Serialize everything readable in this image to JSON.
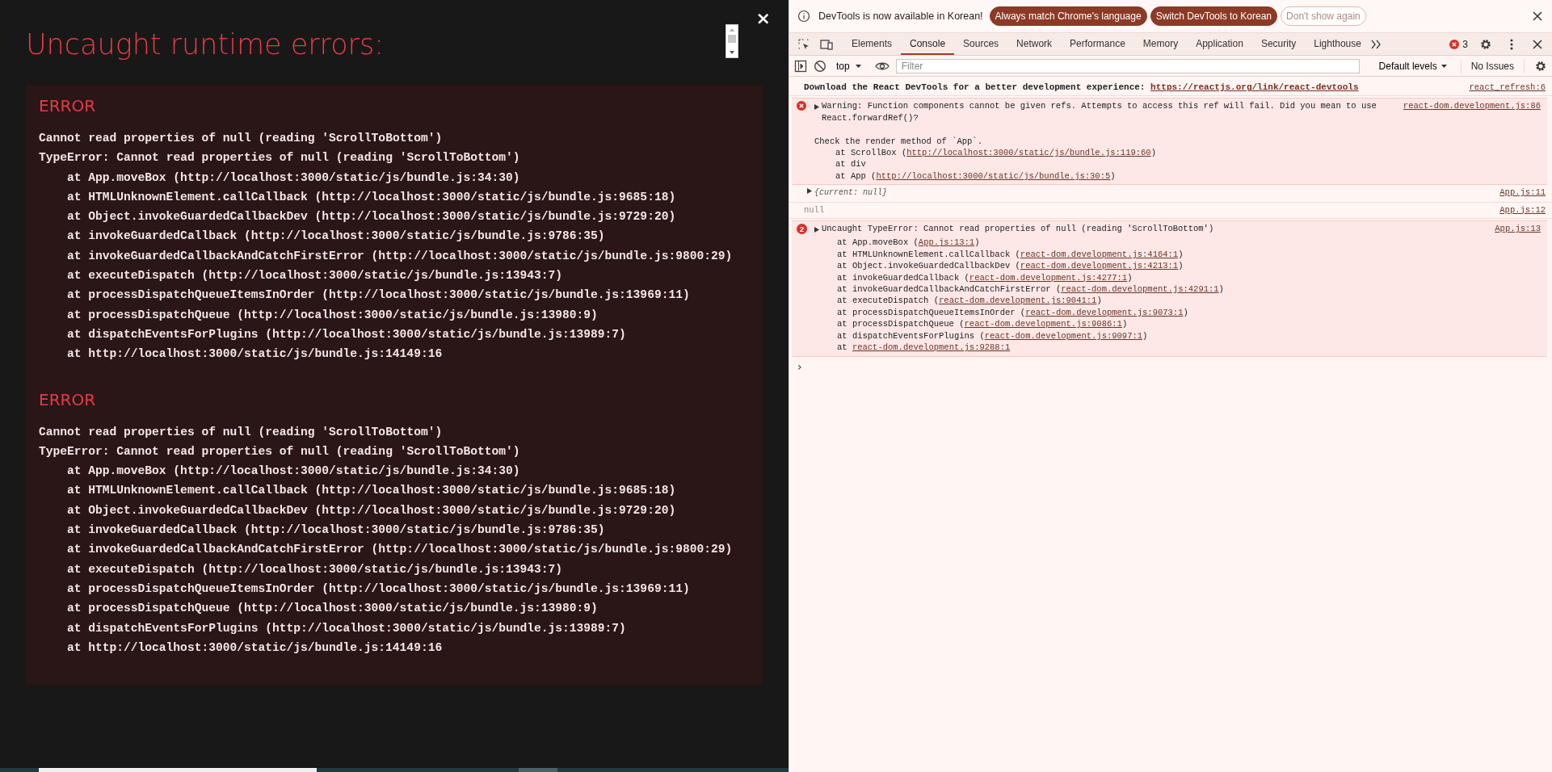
{
  "overlay": {
    "title": "Uncaught runtime errors:",
    "close": "×",
    "errors": [
      {
        "label": "ERROR",
        "lines": [
          "Cannot read properties of null (reading 'ScrollToBottom')",
          "TypeError: Cannot read properties of null (reading 'ScrollToBottom')"
        ],
        "stack": [
          "at App.moveBox (http://localhost:3000/static/js/bundle.js:34:30)",
          "at HTMLUnknownElement.callCallback (http://localhost:3000/static/js/bundle.js:9685:18)",
          "at Object.invokeGuardedCallbackDev (http://localhost:3000/static/js/bundle.js:9729:20)",
          "at invokeGuardedCallback (http://localhost:3000/static/js/bundle.js:9786:35)",
          "at invokeGuardedCallbackAndCatchFirstError (http://localhost:3000/static/js/bundle.js:9800:29)",
          "at executeDispatch (http://localhost:3000/static/js/bundle.js:13943:7)",
          "at processDispatchQueueItemsInOrder (http://localhost:3000/static/js/bundle.js:13969:11)",
          "at processDispatchQueue (http://localhost:3000/static/js/bundle.js:13980:9)",
          "at dispatchEventsForPlugins (http://localhost:3000/static/js/bundle.js:13989:7)",
          "at http://localhost:3000/static/js/bundle.js:14149:16"
        ]
      },
      {
        "label": "ERROR",
        "lines": [
          "Cannot read properties of null (reading 'ScrollToBottom')",
          "TypeError: Cannot read properties of null (reading 'ScrollToBottom')"
        ],
        "stack": [
          "at App.moveBox (http://localhost:3000/static/js/bundle.js:34:30)",
          "at HTMLUnknownElement.callCallback (http://localhost:3000/static/js/bundle.js:9685:18)",
          "at Object.invokeGuardedCallbackDev (http://localhost:3000/static/js/bundle.js:9729:20)",
          "at invokeGuardedCallback (http://localhost:3000/static/js/bundle.js:9786:35)",
          "at invokeGuardedCallbackAndCatchFirstError (http://localhost:3000/static/js/bundle.js:9800:29)",
          "at executeDispatch (http://localhost:3000/static/js/bundle.js:13943:7)",
          "at processDispatchQueueItemsInOrder (http://localhost:3000/static/js/bundle.js:13969:11)",
          "at processDispatchQueue (http://localhost:3000/static/js/bundle.js:13980:9)",
          "at dispatchEventsForPlugins (http://localhost:3000/static/js/bundle.js:13989:7)",
          "at http://localhost:3000/static/js/bundle.js:14149:16"
        ]
      }
    ]
  },
  "devtools": {
    "infobar": {
      "message": "DevTools is now available in Korean!",
      "buttons": [
        {
          "label": "Always match Chrome's language",
          "kind": "primary"
        },
        {
          "label": "Switch DevTools to Korean",
          "kind": "primary"
        },
        {
          "label": "Don't show again",
          "kind": "outline"
        }
      ]
    },
    "tabs": [
      {
        "label": "Elements",
        "selected": false
      },
      {
        "label": "Console",
        "selected": true
      },
      {
        "label": "Sources",
        "selected": false
      },
      {
        "label": "Network",
        "selected": false
      },
      {
        "label": "Performance",
        "selected": false
      },
      {
        "label": "Memory",
        "selected": false
      },
      {
        "label": "Application",
        "selected": false
      },
      {
        "label": "Security",
        "selected": false
      },
      {
        "label": "Lighthouse",
        "selected": false
      }
    ],
    "error_count": "3",
    "toolbar": {
      "context": "top",
      "filter_placeholder": "Filter",
      "levels": "Default levels",
      "issues": "No Issues"
    },
    "messages": [
      {
        "kind": "banner",
        "text": "Download the React DevTools for a better development experience: ",
        "link": "https://reactjs.org/link/react-devtools",
        "source": "react_refresh:6"
      },
      {
        "kind": "warning",
        "expanded": false,
        "text": "Warning: Function components cannot be given refs. Attempts to access this ref will fail. Did you mean to use React.forwardRef()?",
        "note": "Check the render method of `App`.",
        "stack": [
          {
            "before": "at ScrollBox (",
            "link": "http://localhost:3000/static/js/bundle.js:119:60",
            "after": ")"
          },
          {
            "before": "at div"
          },
          {
            "before": "at App (",
            "link": "http://localhost:3000/static/js/bundle.js:30:5",
            "after": ")"
          }
        ],
        "source": "react-dom.development.js:86"
      },
      {
        "kind": "object",
        "expanded": false,
        "text": "{current: null}",
        "source": "App.js:11"
      },
      {
        "kind": "null",
        "text": "null",
        "source": "App.js:12"
      },
      {
        "kind": "error",
        "expanded": false,
        "count": "2",
        "text": "Uncaught TypeError: Cannot read properties of null (reading 'ScrollToBottom')",
        "stack": [
          {
            "before": "at App.moveBox (",
            "link": "App.js:13:1",
            "after": ")"
          },
          {
            "before": "at HTMLUnknownElement.callCallback (",
            "link": "react-dom.development.js:4164:1",
            "after": ")"
          },
          {
            "before": "at Object.invokeGuardedCallbackDev (",
            "link": "react-dom.development.js:4213:1",
            "after": ")"
          },
          {
            "before": "at invokeGuardedCallback (",
            "link": "react-dom.development.js:4277:1",
            "after": ")"
          },
          {
            "before": "at invokeGuardedCallbackAndCatchFirstError (",
            "link": "react-dom.development.js:4291:1",
            "after": ")"
          },
          {
            "before": "at executeDispatch (",
            "link": "react-dom.development.js:9041:1",
            "after": ")"
          },
          {
            "before": "at processDispatchQueueItemsInOrder (",
            "link": "react-dom.development.js:9073:1",
            "after": ")"
          },
          {
            "before": "at processDispatchQueue (",
            "link": "react-dom.development.js:9086:1",
            "after": ")"
          },
          {
            "before": "at dispatchEventsForPlugins (",
            "link": "react-dom.development.js:9097:1",
            "after": ")"
          },
          {
            "before": "at ",
            "link": "react-dom.development.js:9288:1"
          }
        ],
        "source": "App.js:13"
      }
    ],
    "prompt": "›"
  }
}
